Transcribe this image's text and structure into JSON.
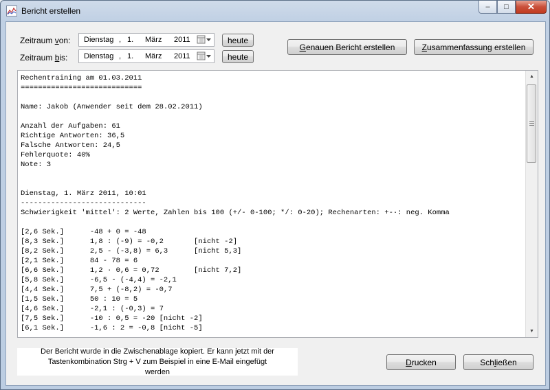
{
  "window": {
    "title": "Bericht erstellen"
  },
  "period": {
    "from_label_pre": "Zeitraum ",
    "from_label_key": "v",
    "from_label_post": "on:",
    "to_label_pre": "Zeitraum ",
    "to_label_key": "b",
    "to_label_post": "is:",
    "from": {
      "weekday": "Dienstag",
      "sep": ",",
      "day": "1.",
      "month": "März",
      "year": "2011"
    },
    "to": {
      "weekday": "Dienstag",
      "sep": ",",
      "day": "1.",
      "month": "März",
      "year": "2011"
    },
    "today_label": "heute"
  },
  "actions": {
    "detailed_pre": "",
    "detailed_key": "G",
    "detailed_post": "enauen Bericht erstellen",
    "summary_pre": "",
    "summary_key": "Z",
    "summary_post": "usammenfassung erstellen"
  },
  "report_lines": [
    "Rechentraining am 01.03.2011",
    "============================",
    "",
    "Name: Jakob (Anwender seit dem 28.02.2011)",
    "",
    "Anzahl der Aufgaben: 61",
    "Richtige Antworten: 36,5",
    "Falsche Antworten: 24,5",
    "Fehlerquote: 40%",
    "Note: 3",
    "",
    "",
    "Dienstag, 1. März 2011, 10:01",
    "-----------------------------",
    "Schwierigkeit 'mittel': 2 Werte, Zahlen bis 100 (+/- 0-100; */: 0-20); Rechenarten: +-·: neg. Komma",
    "",
    "[2,6 Sek.]      -48 + 0 = -48",
    "[8,3 Sek.]      1,8 : (-9) = -0,2       [nicht -2]",
    "[8,2 Sek.]      2,5 - (-3,8) = 6,3      [nicht 5,3]",
    "[2,1 Sek.]      84 - 78 = 6",
    "[6,6 Sek.]      1,2 · 0,6 = 0,72        [nicht 7,2]",
    "[5,8 Sek.]      -6,5 - (-4,4) = -2,1",
    "[4,4 Sek.]      7,5 + (-8,2) = -0,7",
    "[1,5 Sek.]      50 : 10 = 5",
    "[4,6 Sek.]      -2,1 : (-0,3) = 7",
    "[7,5 Sek.]      -10 : 0,5 = -20 [nicht -2]",
    "[6,1 Sek.]      -1,6 : 2 = -0,8 [nicht -5]"
  ],
  "status_message": "Der Bericht wurde in die Zwischenablage kopiert. Er kann jetzt mit der Tastenkombination Strg + V zum Beispiel in eine E-Mail eingefügt werden",
  "footer": {
    "print_pre": "",
    "print_key": "D",
    "print_post": "rucken",
    "close_pre": "Sch",
    "close_key": "l",
    "close_post": "ießen"
  },
  "icons": {
    "app": "chart-icon",
    "calendar": "calendar-icon",
    "minimize": "minimize-icon",
    "maximize": "maximize-icon",
    "close": "close-icon"
  },
  "colors": {
    "title_close": "#c23b20",
    "frame": "#bccde2"
  }
}
